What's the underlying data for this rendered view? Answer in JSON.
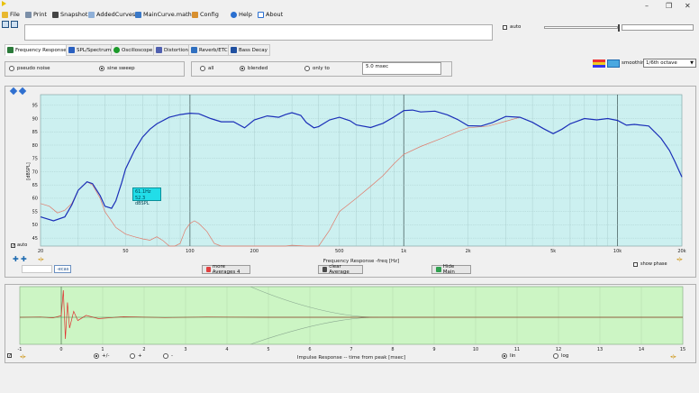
{
  "window": {
    "minimize": "–",
    "maximize": "❐",
    "close": "✕"
  },
  "menu": {
    "items": [
      {
        "label": "File",
        "icon": "folder-icon"
      },
      {
        "label": "Print",
        "icon": "printer-icon"
      },
      {
        "label": "Snapshot",
        "icon": "camera-icon"
      },
      {
        "label": "AddedCurves",
        "icon": "curves-icon"
      },
      {
        "label": "MainCurve.math",
        "icon": "calculator-icon"
      },
      {
        "label": "Config",
        "icon": "tools-icon"
      },
      {
        "label": "Help",
        "icon": "help-icon"
      },
      {
        "label": "About",
        "icon": "speech-icon"
      }
    ]
  },
  "top": {
    "auto_label": "auto"
  },
  "tabs": [
    {
      "label": "Frequency Response",
      "active": true
    },
    {
      "label": "SPL/Spectrum",
      "active": false
    },
    {
      "label": "Oscilloscope",
      "active": false
    },
    {
      "label": "Distortion",
      "active": false
    },
    {
      "label": "Reverb/ETC",
      "active": false
    },
    {
      "label": "Bass Decay",
      "active": false
    }
  ],
  "signal": {
    "pseudo_noise": "pseudo noise",
    "sine_sweep": "sine sweep",
    "selected": "sine sweep"
  },
  "window_mode": {
    "all": "all",
    "blended": "blended",
    "only_to": "only to",
    "selected": "blended",
    "time_value": "5.0 msec"
  },
  "smoothing": {
    "label": "smoothing",
    "value": "1/6th octave"
  },
  "fr_chart": {
    "ylabel": "[dBSPL]",
    "xlabel": "Frequency Response -freq [Hz]",
    "auto_label": "auto",
    "cursor_readout": [
      "61.1Hz",
      "52.3 dBSPL"
    ],
    "bottom_small_label": "-ecas"
  },
  "buttons": {
    "more_averages": "more Averages 4",
    "clear_average": "clear Average",
    "hide_main": "Hide Main",
    "show_phase": "show phase"
  },
  "ir_chart": {
    "xlabel": "Impulse Response  -- time from peak [msec]",
    "polarity": {
      "pm": "+/-",
      "plus": "+",
      "minus": "-",
      "selected": "+/-"
    },
    "scale": {
      "lin": "lin",
      "log": "log",
      "selected": "lin"
    }
  },
  "colors": {
    "plot_bg": "#ccf0f0",
    "ir_bg": "#ccf5c4",
    "main_curve": "#1b2fb8",
    "ref_curve": "#e07a6a",
    "cursor_box": "#22dde8"
  },
  "chart_data": [
    {
      "type": "line",
      "title": "",
      "xlabel": "Frequency Response -freq [Hz]",
      "ylabel": "[dBSPL]",
      "x_scale": "log",
      "xlim": [
        20,
        20000
      ],
      "ylim": [
        42,
        99
      ],
      "x_ticks": [
        20,
        50,
        100,
        200,
        500,
        1000,
        2000,
        5000,
        10000,
        20000
      ],
      "x_tick_labels": [
        "20",
        "50",
        "100",
        "200",
        "500",
        "1k",
        "2k",
        "5k",
        "10k",
        "20k"
      ],
      "y_ticks": [
        45,
        50,
        55,
        60,
        65,
        70,
        75,
        80,
        85,
        90,
        95
      ],
      "grid": true,
      "series": [
        {
          "color": "#1b2fb8",
          "x": [
            20,
            23,
            26,
            28,
            30,
            33,
            35,
            38,
            40,
            43,
            45,
            48,
            50,
            55,
            60,
            65,
            70,
            80,
            90,
            100,
            110,
            125,
            140,
            160,
            180,
            200,
            230,
            260,
            280,
            300,
            330,
            350,
            380,
            400,
            450,
            500,
            560,
            600,
            700,
            800,
            900,
            1000,
            1100,
            1200,
            1400,
            1600,
            1800,
            2000,
            2300,
            2600,
            3000,
            3500,
            4000,
            4500,
            5000,
            5500,
            6000,
            7000,
            8000,
            9000,
            10000,
            11000,
            12000,
            14000,
            16000,
            17500,
            18500,
            20000
          ],
          "y": [
            53,
            51.5,
            53,
            57.5,
            63,
            66.2,
            65.5,
            61,
            57,
            56.2,
            59,
            66,
            71,
            78,
            83,
            86,
            88,
            90.5,
            91.5,
            92,
            91.8,
            90,
            88.8,
            88.8,
            86.5,
            89.5,
            91,
            90.5,
            91.5,
            92.2,
            91.2,
            88.5,
            86.5,
            87,
            89.5,
            90.5,
            89.2,
            87.6,
            86.6,
            88.2,
            90.6,
            93,
            93.2,
            92.5,
            92.8,
            91.4,
            89.5,
            87.3,
            87.2,
            88.5,
            90.8,
            90.5,
            88.6,
            86.2,
            84.3,
            86,
            88,
            90,
            89.5,
            90,
            89.3,
            87.5,
            87.8,
            87.2,
            82.5,
            78,
            74,
            68
          ]
        },
        {
          "color": "#e07a6a",
          "x": [
            20,
            22,
            24,
            26,
            28,
            30,
            33,
            35,
            38,
            40,
            45,
            50,
            55,
            60,
            65,
            70,
            75,
            80,
            85,
            90,
            95,
            100,
            105,
            110,
            120,
            130,
            140,
            160,
            180,
            200,
            220,
            250,
            280,
            300,
            350,
            400,
            450,
            500,
            600,
            700,
            800,
            900,
            1000,
            1200,
            1500,
            1800,
            2000,
            2500,
            3000,
            3500
          ],
          "y": [
            58,
            57,
            54.5,
            55.5,
            58,
            63,
            66.2,
            65,
            60,
            55,
            49,
            46.5,
            45.5,
            44.7,
            44.2,
            45.5,
            44,
            42,
            41,
            43,
            48,
            50.5,
            51.5,
            50.5,
            47.5,
            43,
            41.5,
            40,
            41,
            42,
            41.5,
            40,
            41,
            42.3,
            40,
            41,
            48,
            55,
            60,
            64.5,
            68.5,
            73,
            76.5,
            79.5,
            82.5,
            85.2,
            86.5,
            87.2,
            89,
            90.5
          ]
        }
      ],
      "annotations": [
        "61.1Hz",
        "52.3 dBSPL"
      ]
    },
    {
      "type": "line",
      "title": "",
      "xlabel": "Impulse Response  -- time from peak [msec]",
      "xlim": [
        -1,
        15
      ],
      "x_ticks": [
        -1,
        0,
        1,
        2,
        3,
        4,
        5,
        6,
        7,
        8,
        9,
        10,
        11,
        12,
        13,
        14,
        15
      ],
      "grid": true,
      "series": [
        {
          "color": "#e03030",
          "x": [
            -1,
            -0.5,
            -0.2,
            0,
            0.05,
            0.1,
            0.15,
            0.2,
            0.3,
            0.4,
            0.6,
            0.9,
            1.5,
            2.5,
            3.5,
            5,
            7,
            9,
            11,
            13,
            15
          ],
          "y": [
            0,
            0.01,
            -0.02,
            0.06,
            1.0,
            -0.8,
            0.55,
            -0.4,
            0.22,
            -0.12,
            0.07,
            -0.05,
            0.02,
            -0.01,
            0.01,
            0,
            0,
            0,
            0,
            0,
            0
          ]
        }
      ]
    }
  ]
}
